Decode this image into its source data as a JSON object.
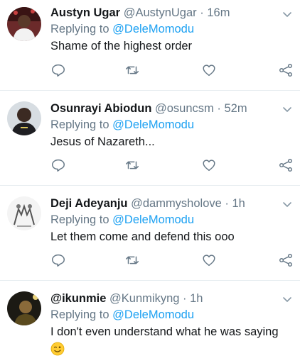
{
  "tweets": [
    {
      "display_name": "Austyn Ugar",
      "handle": "@AustynUgar",
      "separator": "·",
      "time": "16m",
      "replying_prefix": "Replying to",
      "replying_to": "@DeleMomodu",
      "text": "Shame of the highest order"
    },
    {
      "display_name": "Osunrayi Abiodun",
      "handle": "@osuncsm",
      "separator": "·",
      "time": "52m",
      "replying_prefix": "Replying to",
      "replying_to": "@DeleMomodu",
      "text": "Jesus of Nazareth..."
    },
    {
      "display_name": "Deji Adeyanju",
      "handle": "@dammysholove",
      "separator": "·",
      "time": "1h",
      "replying_prefix": "Replying to",
      "replying_to": "@DeleMomodu",
      "text": "Let them come and defend this ooo"
    },
    {
      "display_name": "@ikunmie",
      "handle": "@Kunmikyng",
      "separator": "·",
      "time": "1h",
      "replying_prefix": "Replying to",
      "replying_to": "@DeleMomodu",
      "text": "I don't even understand what he was saying",
      "emoji": "winking-face-emoji"
    }
  ],
  "icons": {
    "reply": "reply-icon",
    "retweet": "retweet-icon",
    "like": "like-icon",
    "share": "share-icon",
    "menu": "chevron-down-icon"
  },
  "colors": {
    "link": "#1da1f2",
    "secondary": "#657786",
    "divider": "#e6ecf0"
  }
}
